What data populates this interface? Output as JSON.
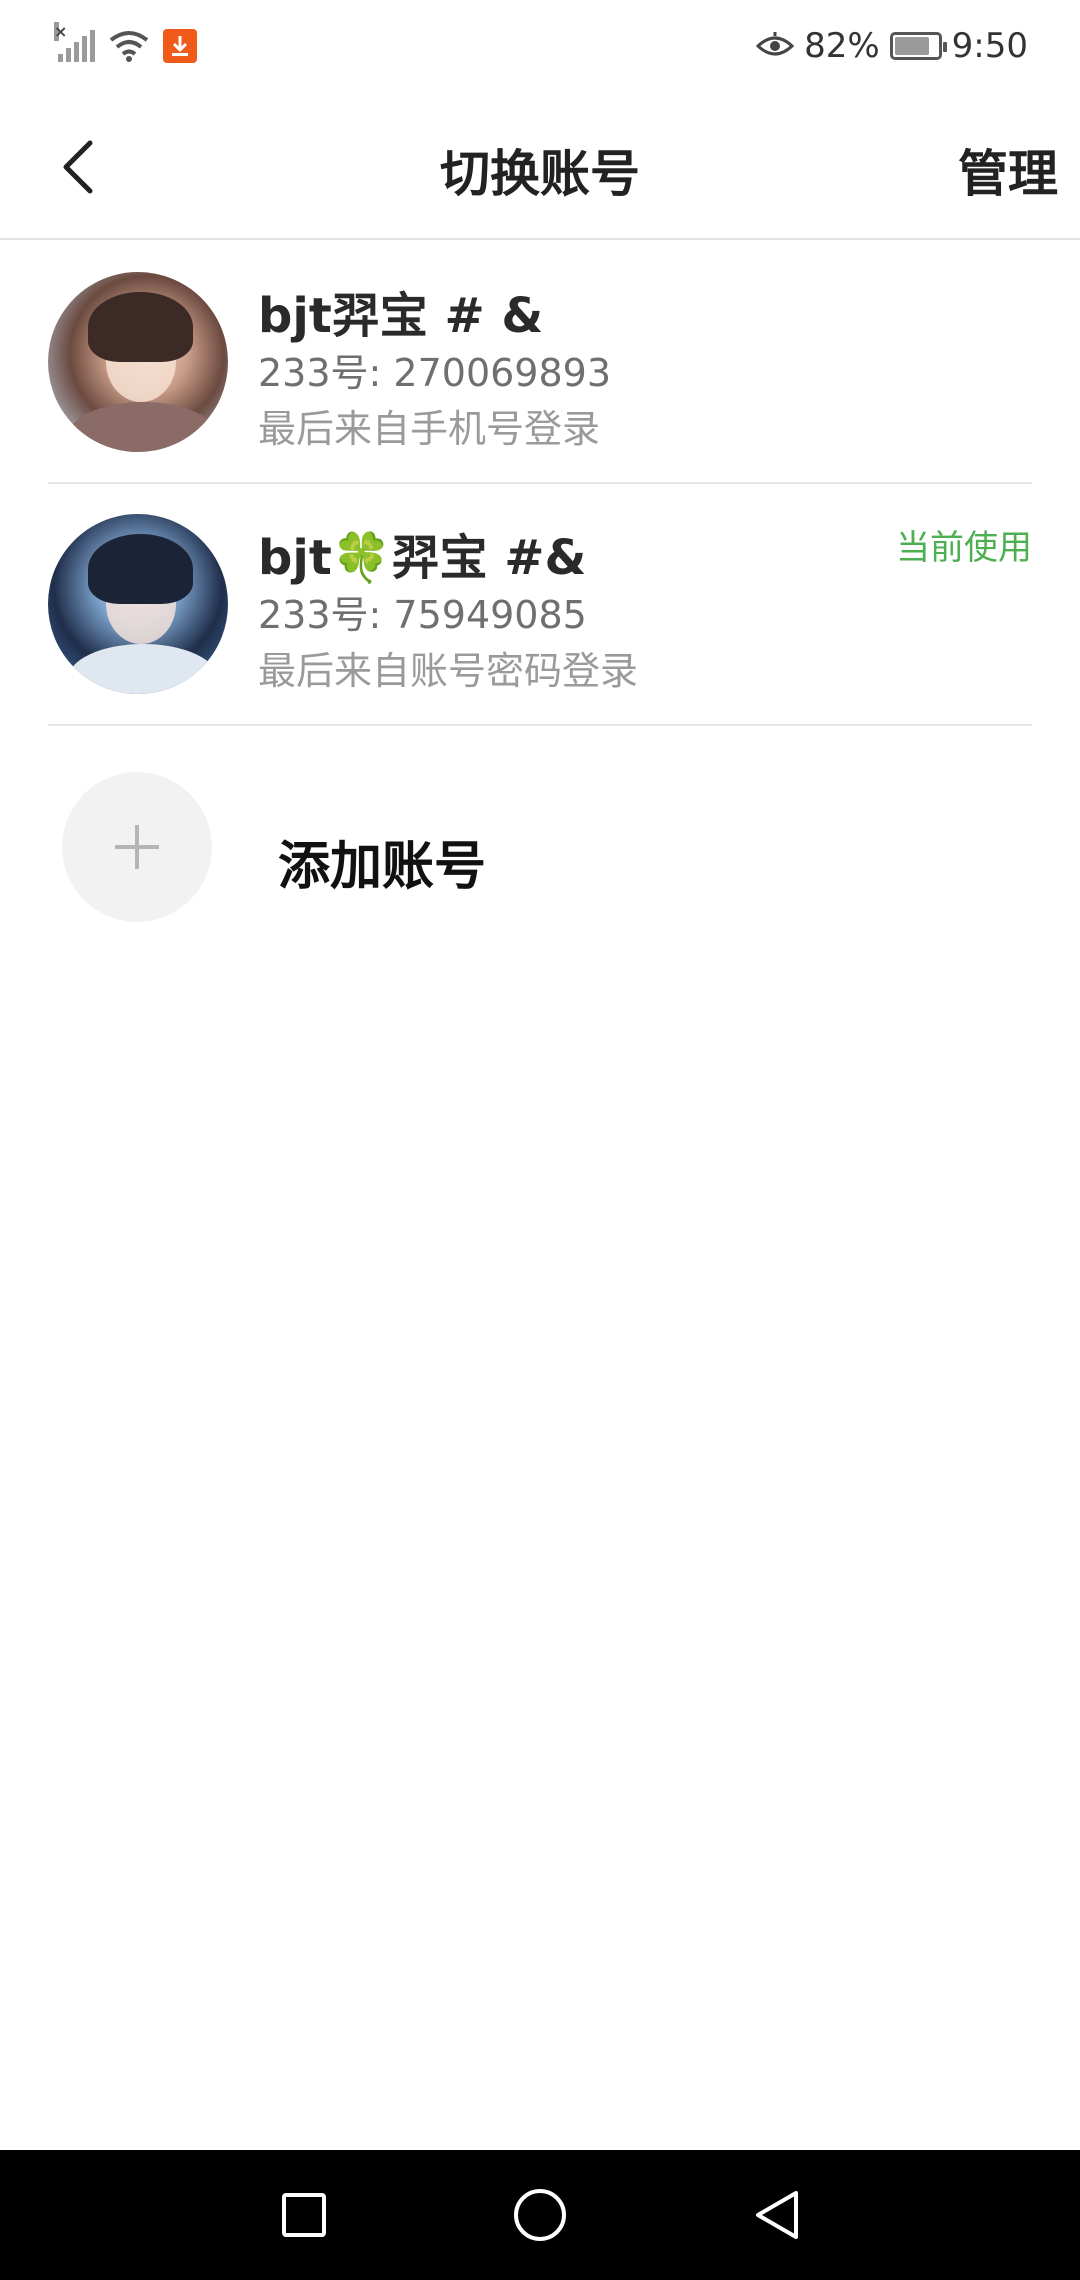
{
  "status_bar": {
    "battery": "82%",
    "time": "9:50",
    "battery_level": 0.82
  },
  "header": {
    "title": "切换账号",
    "manage_label": "管理"
  },
  "accounts": [
    {
      "name": "bjt羿宝 # &",
      "id_line": "233号: 270069893",
      "login_source": "最后来自手机号登录",
      "current": false
    },
    {
      "name": "bjt🍀羿宝 #&",
      "id_line": "233号: 75949085",
      "login_source": "最后来自账号密码登录",
      "current": true,
      "current_label": "当前使用"
    }
  ],
  "add_account": {
    "label": "添加账号"
  },
  "colors": {
    "accent_green": "#4caf50",
    "download_badge": "#f05a1a",
    "nav_bar": "#000000"
  },
  "icons": {
    "back": "chevron-left-icon",
    "add": "plus-icon",
    "nav_recents": "square-icon",
    "nav_home": "circle-icon",
    "nav_back": "triangle-left-icon"
  }
}
